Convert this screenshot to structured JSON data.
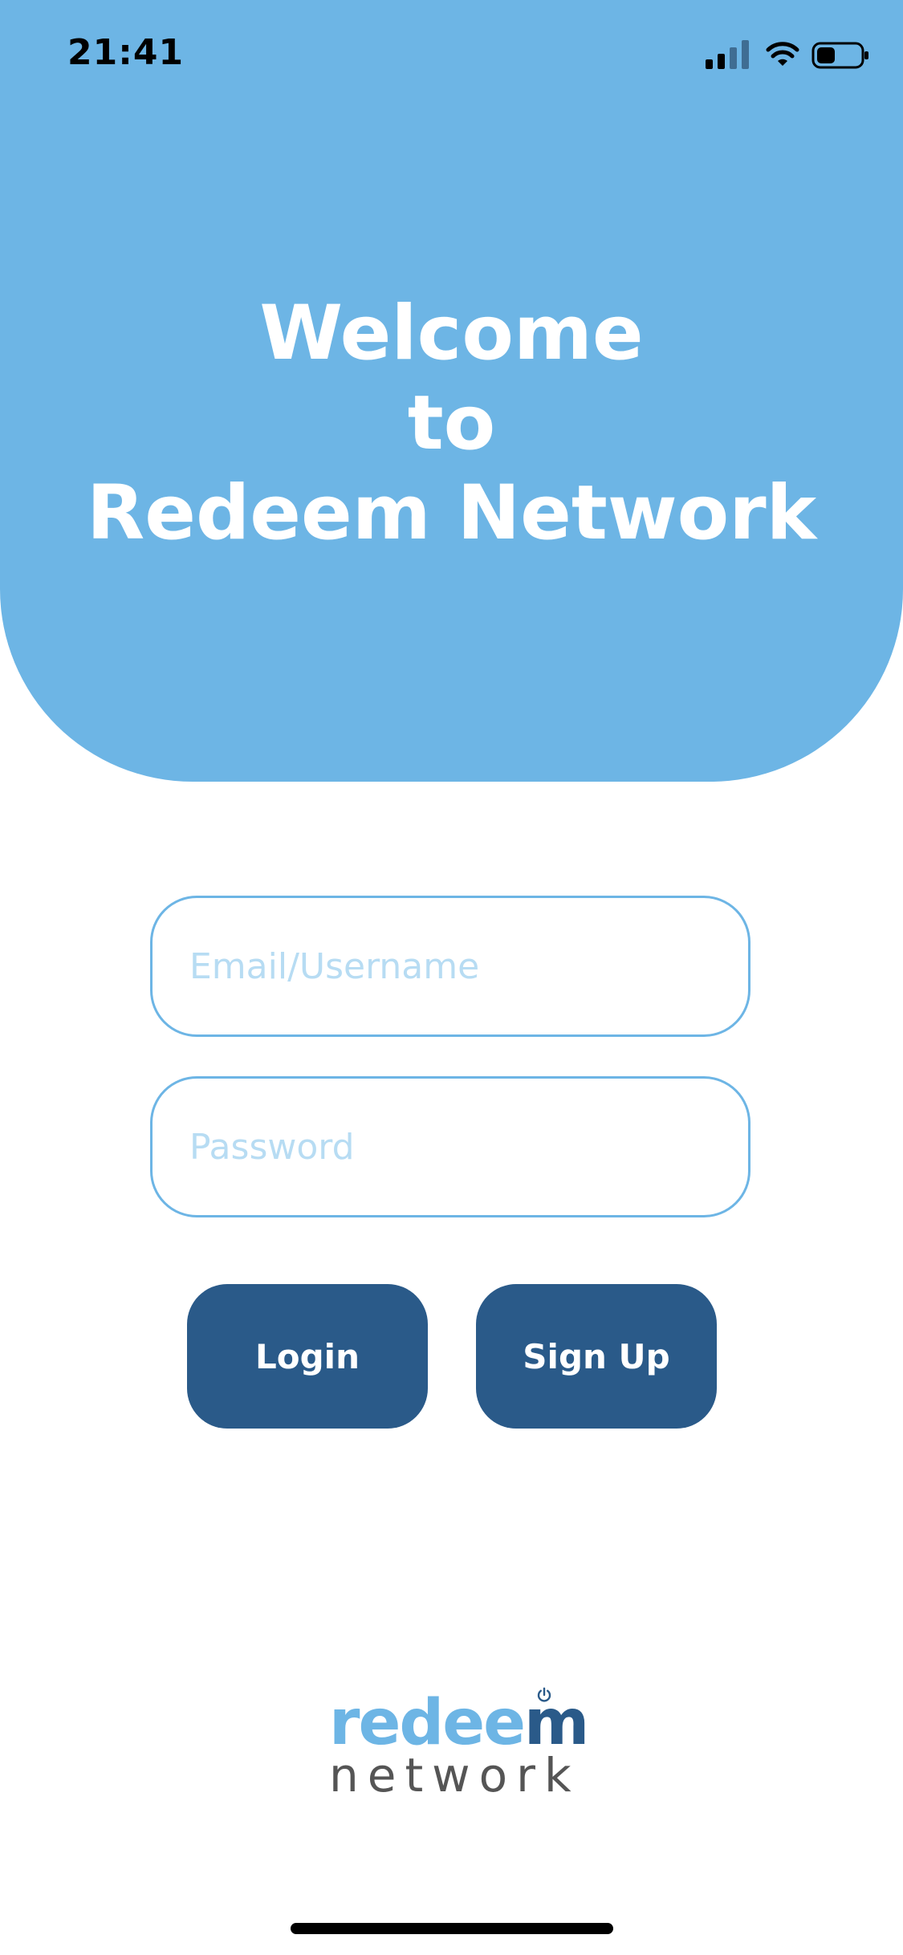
{
  "status_bar": {
    "time": "21:41",
    "icons": [
      "signal-icon",
      "wifi-icon",
      "battery-icon"
    ]
  },
  "header": {
    "line1": "Welcome",
    "line2": "to",
    "line3": "Redeem Network",
    "background_color": "#6db5e5"
  },
  "form": {
    "email_placeholder": "Email/Username",
    "password_placeholder": "Password",
    "email_value": "",
    "password_value": ""
  },
  "buttons": {
    "login_label": "Login",
    "signup_label": "Sign Up",
    "button_color": "#2a5a89"
  },
  "logo": {
    "top_prefix": "redee",
    "top_last": "m",
    "bottom": "network"
  },
  "colors": {
    "accent": "#6db5e5",
    "primary": "#2a5a89",
    "logo_gray": "#555555"
  }
}
